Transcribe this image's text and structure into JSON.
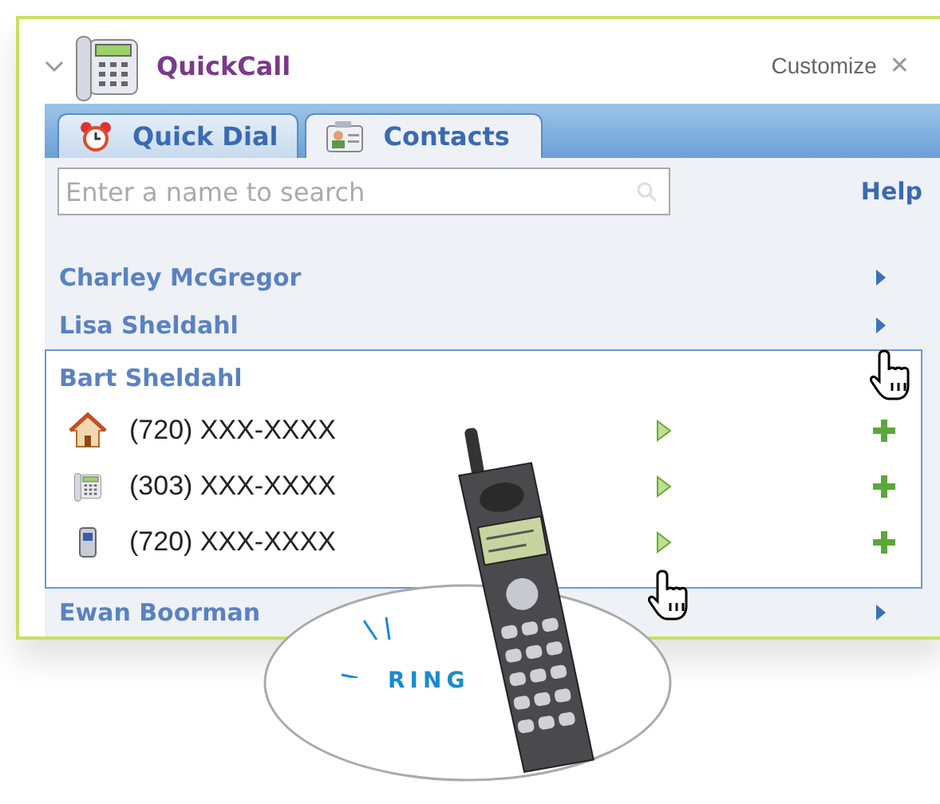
{
  "widget": {
    "title": "QuickCall",
    "customize": "Customize",
    "close": "✕"
  },
  "tabs": [
    {
      "label": "Quick Dial",
      "kind": "clock",
      "selected": false
    },
    {
      "label": "Contacts",
      "kind": "card",
      "selected": true
    }
  ],
  "search": {
    "placeholder": "Enter a name to search"
  },
  "help": "Help",
  "contacts": [
    {
      "name": "Charley McGregor",
      "expanded": false
    },
    {
      "name": "Lisa Sheldahl",
      "expanded": false
    },
    {
      "name": "Bart Sheldahl",
      "expanded": true,
      "numbers": [
        {
          "kind": "home",
          "number": "(720) XXX-XXXX"
        },
        {
          "kind": "office",
          "number": "(303) XXX-XXXX"
        },
        {
          "kind": "mobile",
          "number": "(720) XXX-XXXX"
        }
      ]
    },
    {
      "name": "Ewan Boorman",
      "expanded": false
    }
  ],
  "callout": {
    "text": "RING"
  }
}
